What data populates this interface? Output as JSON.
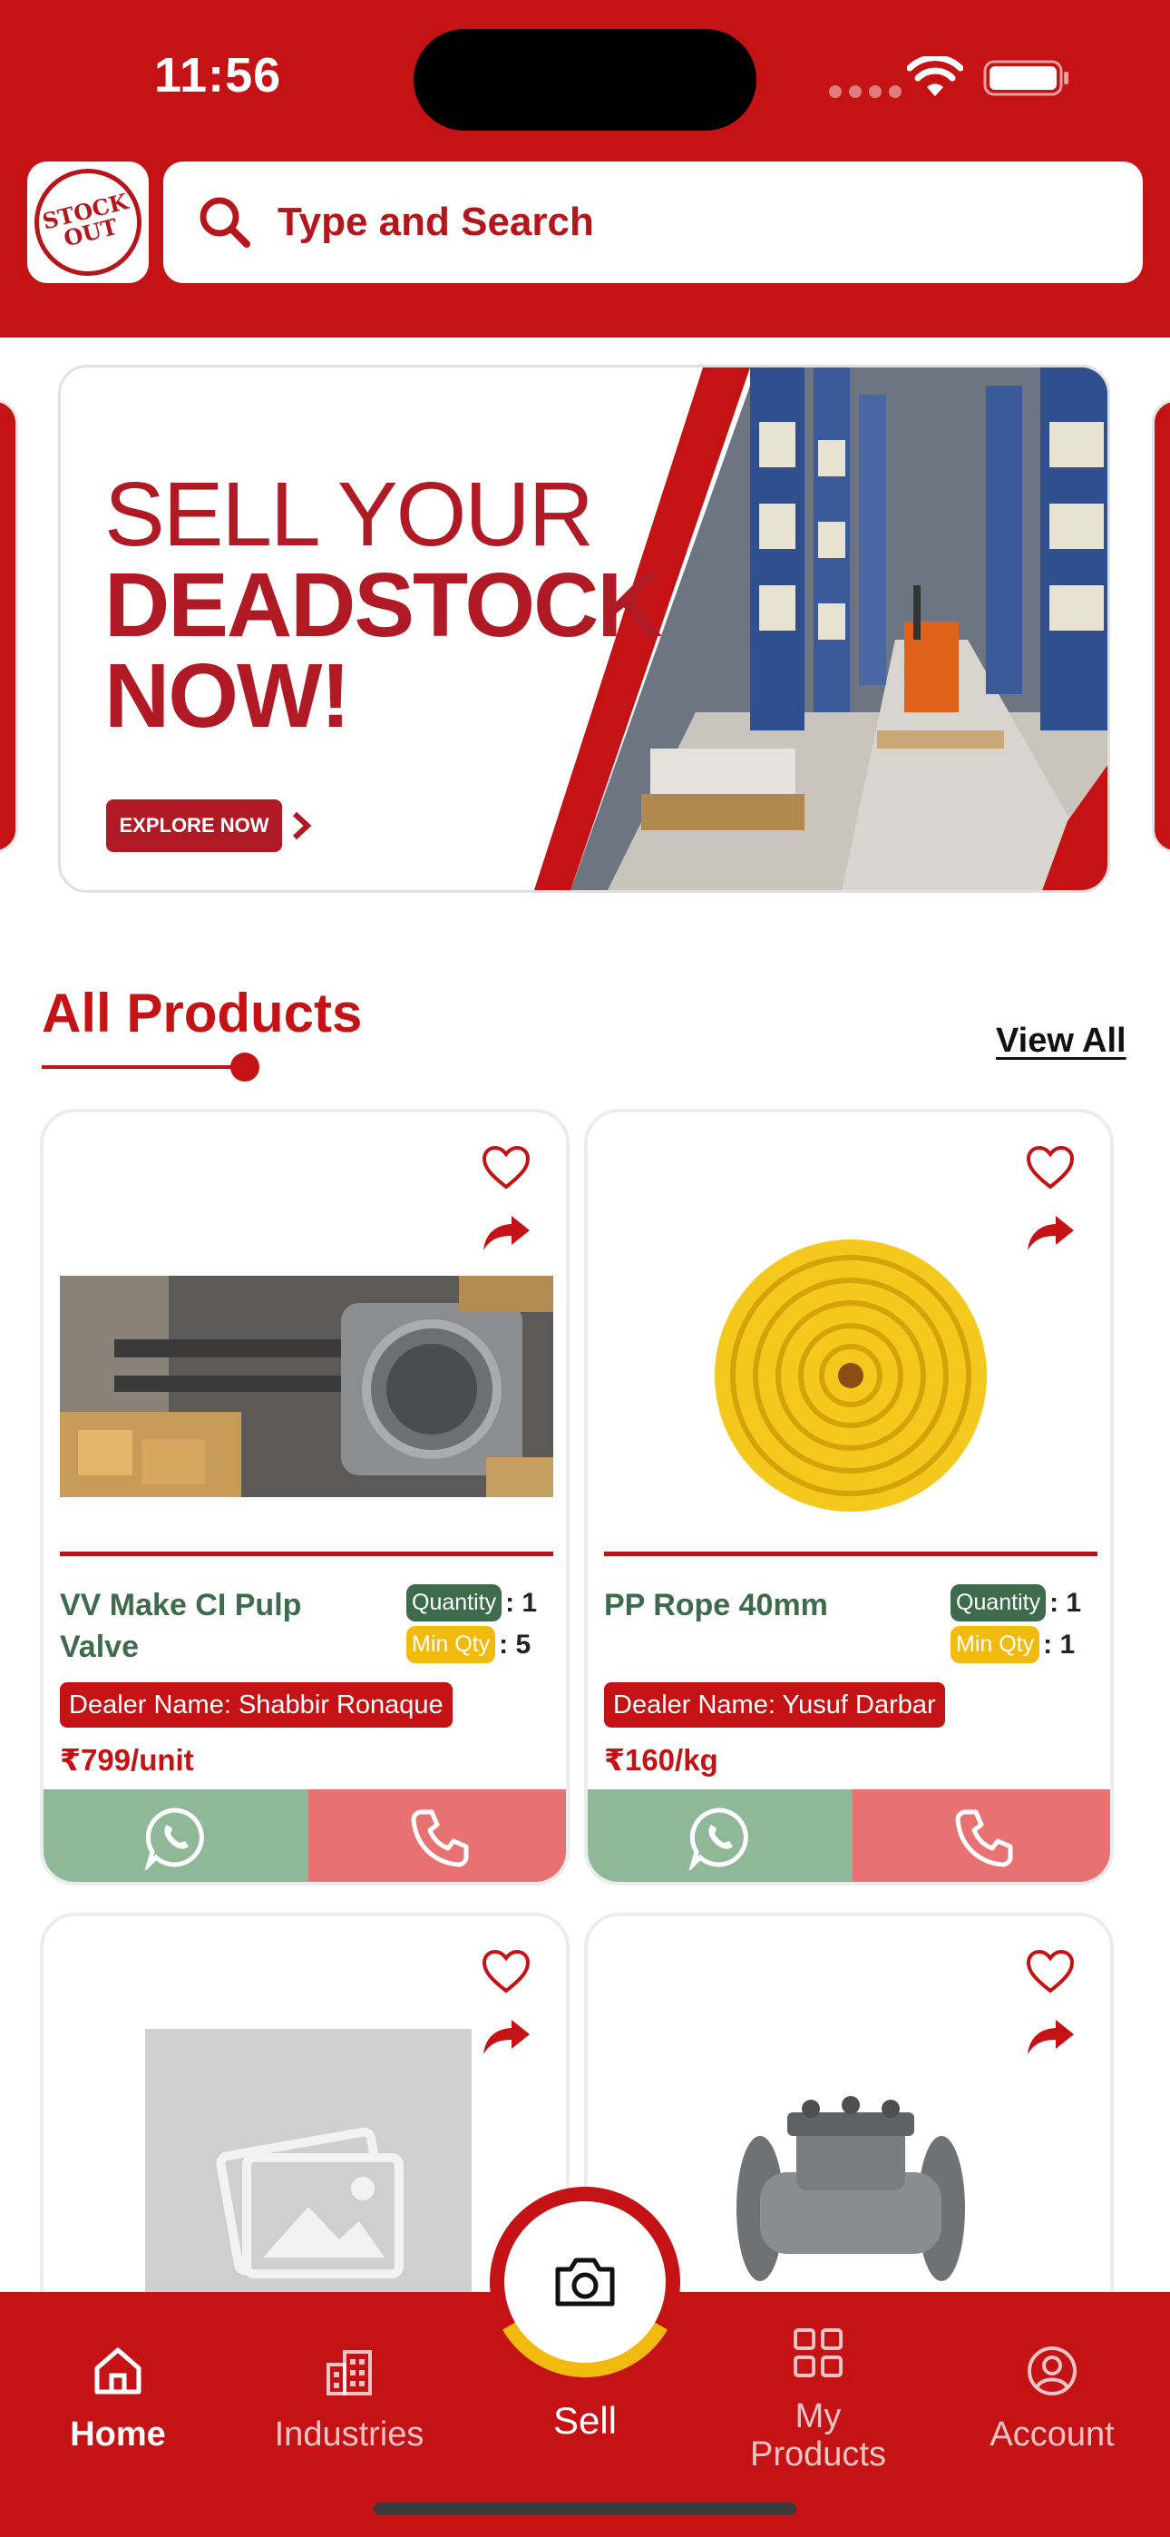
{
  "status_bar": {
    "time": "11:56"
  },
  "header": {
    "logo_text": [
      "STOCK",
      "OUT"
    ],
    "search_placeholder": "Type and Search"
  },
  "banner": {
    "line1": "SELL YOUR",
    "line2": "DEADSTOCK",
    "line3": "NOW!",
    "cta": "EXPLORE NOW"
  },
  "section": {
    "title": "All Products",
    "view_all": "View All"
  },
  "products": [
    {
      "name": "VV Make CI Pulp Valve",
      "quantity_label": "Quantity",
      "quantity": ": 1",
      "min_qty_label": "Min Qty",
      "min_qty": ": 5",
      "dealer": "Dealer Name: Shabbir Ronaque",
      "price": "₹799/unit",
      "image": "pulp-valve-photo"
    },
    {
      "name": "PP Rope 40mm",
      "quantity_label": "Quantity",
      "quantity": ": 1",
      "min_qty_label": "Min Qty",
      "min_qty": ": 1",
      "dealer": "Dealer Name: Yusuf Darbar",
      "price": "₹160/kg",
      "image": "yellow-rope-photo"
    },
    {
      "image": "placeholder-image-icon"
    },
    {
      "image": "check-valve-photo"
    }
  ],
  "bottom_nav": {
    "home": "Home",
    "industries": "Industries",
    "sell": "Sell",
    "my_products": "My Products",
    "account": "Account"
  },
  "colors": {
    "brand_red": "#c41215",
    "green": "#3d6b4c",
    "whatsapp_bg": "#8fb898",
    "call_bg": "#e87272",
    "yellow": "#f2b90f"
  }
}
